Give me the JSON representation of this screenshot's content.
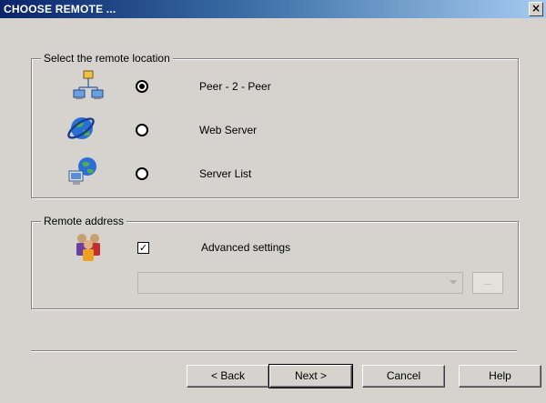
{
  "window": {
    "title": "CHOOSE REMOTE ...",
    "close_label": "×"
  },
  "location_group": {
    "legend": "Select the remote location",
    "options": [
      {
        "label": "Peer - 2 - Peer",
        "selected": true,
        "icon": "network-computers-icon"
      },
      {
        "label": "Web Server",
        "selected": false,
        "icon": "globe-icon"
      },
      {
        "label": "Server List",
        "selected": false,
        "icon": "computer-globe-icon"
      }
    ]
  },
  "address_group": {
    "legend": "Remote address",
    "advanced_label": "Advanced settings",
    "advanced_checked": true,
    "address_value": "",
    "browse_label": "...",
    "icon": "users-icon"
  },
  "buttons": {
    "back": "< Back",
    "next": "Next >",
    "cancel": "Cancel",
    "help": "Help"
  }
}
